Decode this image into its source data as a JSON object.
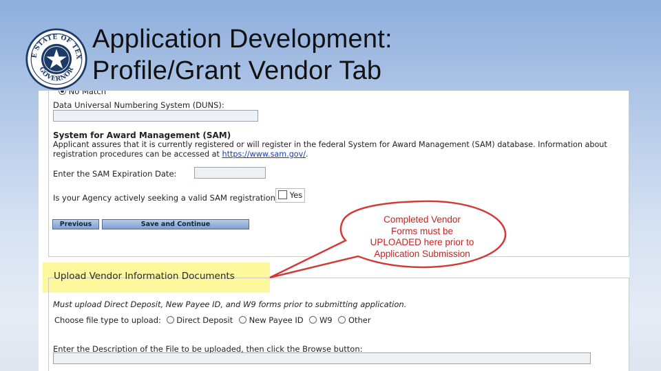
{
  "slide": {
    "title_line1": "Application Development:",
    "title_line2": "Profile/Grant Vendor Tab"
  },
  "seal": {
    "icon": "texas-governor-seal-icon",
    "text_top": "THE STATE OF TEXAS",
    "text_bottom": "GOVERNOR"
  },
  "form": {
    "no_match_label": "No Match",
    "duns_label": "Data Universal Numbering System (DUNS):",
    "duns_value": "",
    "sam_heading": "System for Award Management (SAM)",
    "sam_text_line1": "Applicant assures that it is currently registered or will register in the federal System for Award Management (SAM) database. Information about",
    "sam_text_line2_prefix": "registration procedures can be accessed at ",
    "sam_link": "https://www.sam.gov/",
    "sam_text_line2_suffix": ".",
    "sam_expiration_label": "Enter the SAM Expiration Date:",
    "sam_expiration_value": "",
    "sam_seeking_label": "Is your Agency actively seeking a valid SAM registration?",
    "sam_seeking_checkbox_label": "Yes",
    "previous_button": "Previous",
    "save_continue_button": "Save and Continue"
  },
  "upload": {
    "legend": "Upload Vendor Information Documents",
    "instruction": "Must upload Direct Deposit, New Payee ID, and W9 forms prior to submitting application.",
    "file_type_label": "Choose file type to upload:",
    "file_types": [
      "Direct Deposit",
      "New Payee ID",
      "W9",
      "Other"
    ],
    "description_label": "Enter the Description of the File to be uploaded, then click the Browse button:",
    "description_value": ""
  },
  "callout": {
    "line1": "Completed Vendor",
    "line2": "Forms must be",
    "line3": "UPLOADED here prior to",
    "line4": "Application Submission",
    "color": "#cc1f1f"
  },
  "colors": {
    "highlight": "#fbf78a",
    "button_blue": "#7ea0d2",
    "link": "#1a3cb0"
  }
}
